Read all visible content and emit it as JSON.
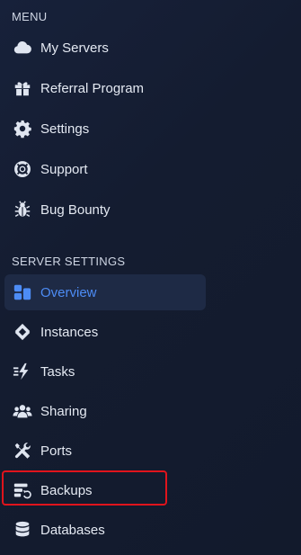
{
  "menu": {
    "title": "MENU",
    "items": [
      {
        "label": "My Servers",
        "icon": "cloud-icon"
      },
      {
        "label": "Referral Program",
        "icon": "gift-icon"
      },
      {
        "label": "Settings",
        "icon": "gear-icon"
      },
      {
        "label": "Support",
        "icon": "lifebuoy-icon"
      },
      {
        "label": "Bug Bounty",
        "icon": "bug-icon"
      }
    ]
  },
  "server_settings": {
    "title": "SERVER SETTINGS",
    "items": [
      {
        "label": "Overview",
        "icon": "dashboard-icon",
        "active": true
      },
      {
        "label": "Instances",
        "icon": "layers-icon"
      },
      {
        "label": "Tasks",
        "icon": "bolt-lines-icon"
      },
      {
        "label": "Sharing",
        "icon": "users-icon"
      },
      {
        "label": "Ports",
        "icon": "tools-icon"
      },
      {
        "label": "Backups",
        "icon": "backup-icon",
        "highlighted": true
      },
      {
        "label": "Databases",
        "icon": "database-icon"
      }
    ]
  },
  "colors": {
    "background": "#141c30",
    "active_bg": "#1e2a45",
    "active_text": "#4d8cf5",
    "highlight": "#e0141c"
  }
}
